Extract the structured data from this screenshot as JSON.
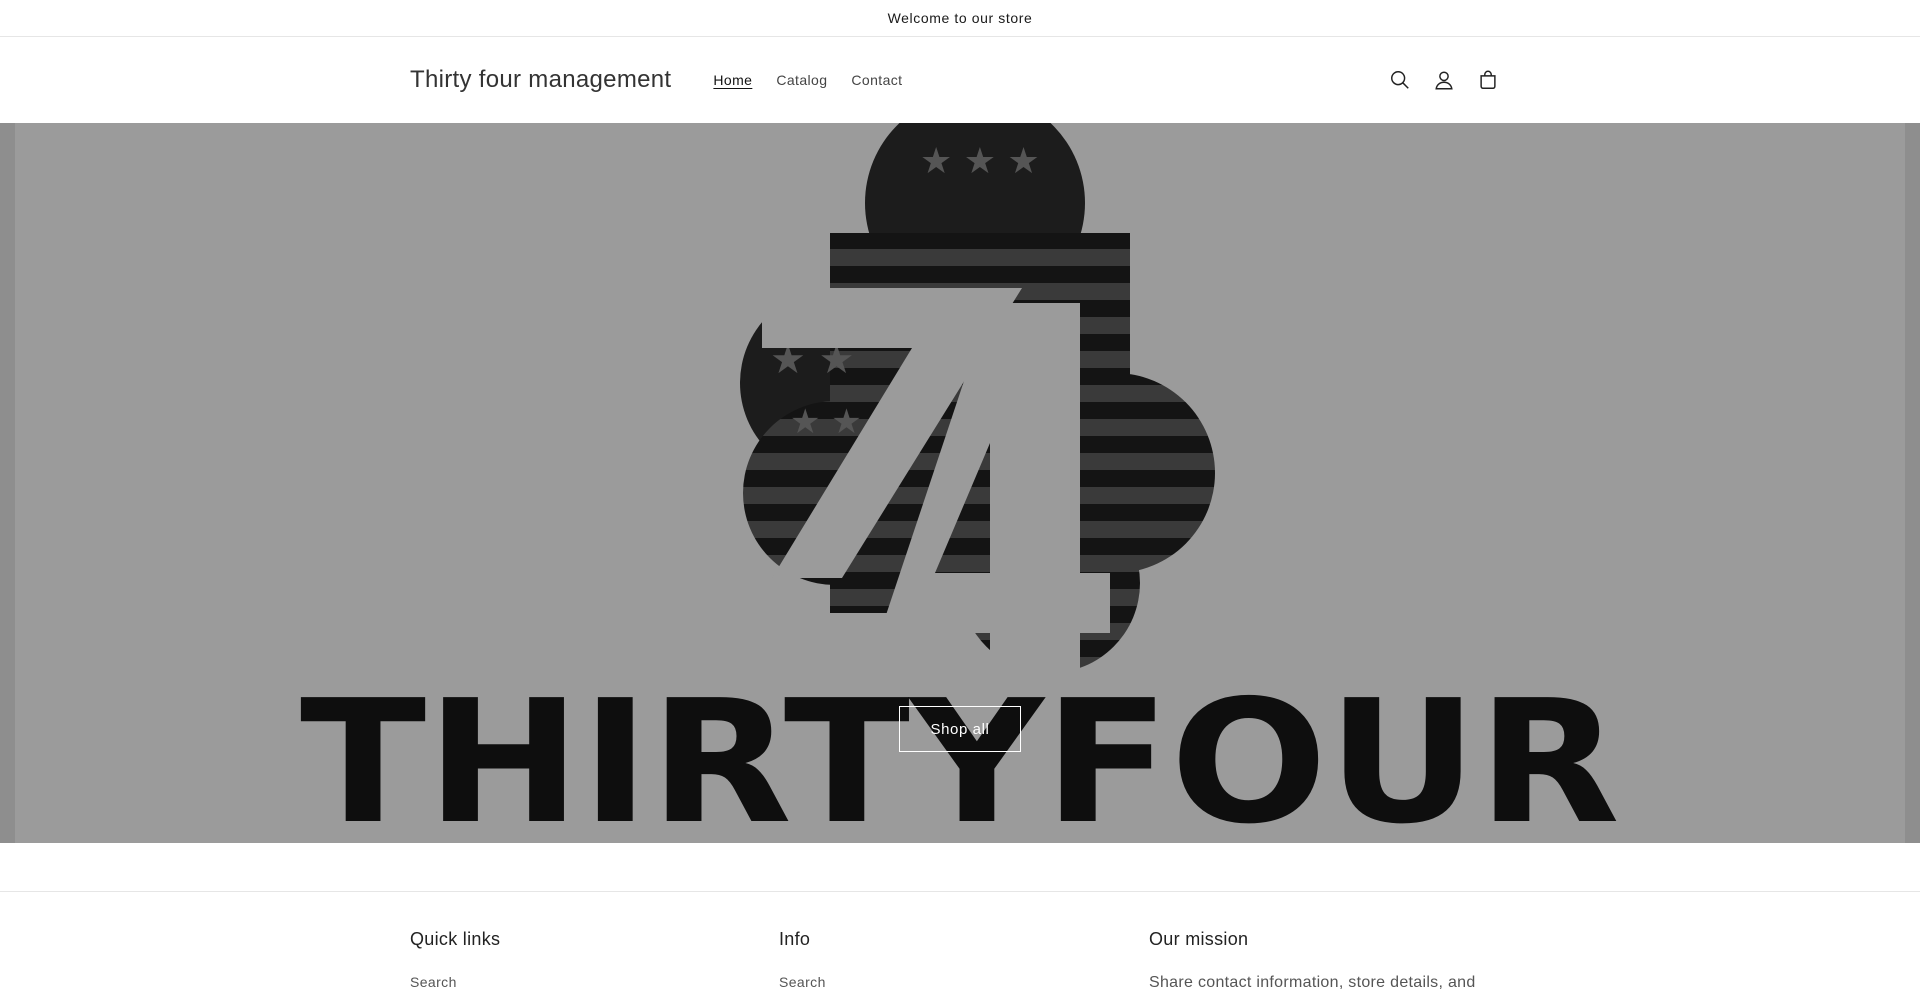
{
  "announcement": {
    "text": "Welcome to our store"
  },
  "header": {
    "store_name": "Thirty four management",
    "nav": [
      {
        "label": "Home",
        "active": true
      },
      {
        "label": "Catalog",
        "active": false
      },
      {
        "label": "Contact",
        "active": false
      }
    ],
    "icons": [
      "search-icon",
      "account-icon",
      "cart-icon"
    ]
  },
  "hero": {
    "logo_text": "34",
    "wordmark": "THIRTYFOUR",
    "cta_label": "Shop all",
    "background_color": "#9b9b9b"
  },
  "footer": {
    "quick_links": {
      "heading": "Quick links",
      "first_link": "Search"
    },
    "info": {
      "heading": "Info",
      "first_link": "Search"
    },
    "mission": {
      "heading": "Our mission",
      "text": "Share contact information, store details, and"
    }
  }
}
